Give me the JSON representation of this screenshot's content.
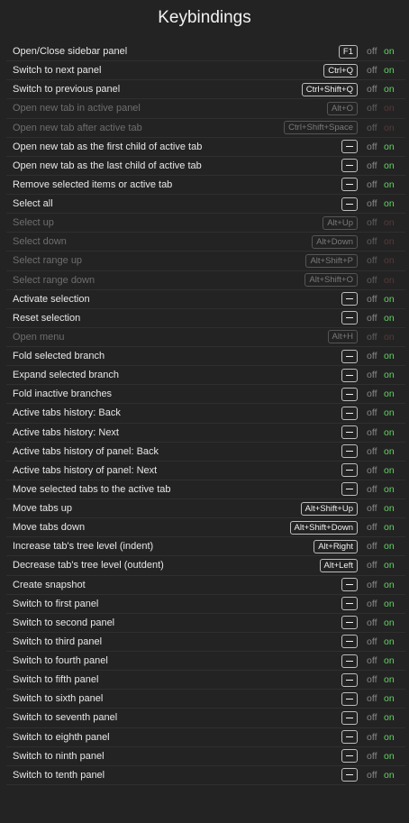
{
  "title": "Keybindings",
  "off_label": "off",
  "on_label": "on",
  "items": [
    {
      "label": "Open/Close sidebar panel",
      "key": "F1",
      "disabled": false
    },
    {
      "label": "Switch to next panel",
      "key": "Ctrl+Q",
      "disabled": false
    },
    {
      "label": "Switch to previous panel",
      "key": "Ctrl+Shift+Q",
      "disabled": false
    },
    {
      "label": "Open new tab in active panel",
      "key": "Alt+O",
      "disabled": true
    },
    {
      "label": "Open new tab after active tab",
      "key": "Ctrl+Shift+Space",
      "disabled": true
    },
    {
      "label": "Open new tab as the first child of active tab",
      "key": "",
      "disabled": false
    },
    {
      "label": "Open new tab as the last child of active tab",
      "key": "",
      "disabled": false
    },
    {
      "label": "Remove selected items or active tab",
      "key": "",
      "disabled": false
    },
    {
      "label": "Select all",
      "key": "",
      "disabled": false
    },
    {
      "label": "Select up",
      "key": "Alt+Up",
      "disabled": true
    },
    {
      "label": "Select down",
      "key": "Alt+Down",
      "disabled": true
    },
    {
      "label": "Select range up",
      "key": "Alt+Shift+P",
      "disabled": true
    },
    {
      "label": "Select range down",
      "key": "Alt+Shift+O",
      "disabled": true
    },
    {
      "label": "Activate selection",
      "key": "",
      "disabled": false
    },
    {
      "label": "Reset selection",
      "key": "",
      "disabled": false
    },
    {
      "label": "Open menu",
      "key": "Alt+H",
      "disabled": true
    },
    {
      "label": "Fold selected branch",
      "key": "",
      "disabled": false
    },
    {
      "label": "Expand selected branch",
      "key": "",
      "disabled": false
    },
    {
      "label": "Fold inactive branches",
      "key": "",
      "disabled": false
    },
    {
      "label": "Active tabs history: Back",
      "key": "",
      "disabled": false
    },
    {
      "label": "Active tabs history: Next",
      "key": "",
      "disabled": false
    },
    {
      "label": "Active tabs history of panel: Back",
      "key": "",
      "disabled": false
    },
    {
      "label": "Active tabs history of panel: Next",
      "key": "",
      "disabled": false
    },
    {
      "label": "Move selected tabs to the active tab",
      "key": "",
      "disabled": false
    },
    {
      "label": "Move tabs up",
      "key": "Alt+Shift+Up",
      "disabled": false
    },
    {
      "label": "Move tabs down",
      "key": "Alt+Shift+Down",
      "disabled": false
    },
    {
      "label": "Increase tab's tree level (indent)",
      "key": "Alt+Right",
      "disabled": false
    },
    {
      "label": "Decrease tab's tree level (outdent)",
      "key": "Alt+Left",
      "disabled": false
    },
    {
      "label": "Create snapshot",
      "key": "",
      "disabled": false
    },
    {
      "label": "Switch to first panel",
      "key": "",
      "disabled": false
    },
    {
      "label": "Switch to second panel",
      "key": "",
      "disabled": false
    },
    {
      "label": "Switch to third panel",
      "key": "",
      "disabled": false
    },
    {
      "label": "Switch to fourth panel",
      "key": "",
      "disabled": false
    },
    {
      "label": "Switch to fifth panel",
      "key": "",
      "disabled": false
    },
    {
      "label": "Switch to sixth panel",
      "key": "",
      "disabled": false
    },
    {
      "label": "Switch to seventh panel",
      "key": "",
      "disabled": false
    },
    {
      "label": "Switch to eighth panel",
      "key": "",
      "disabled": false
    },
    {
      "label": "Switch to ninth panel",
      "key": "",
      "disabled": false
    },
    {
      "label": "Switch to tenth panel",
      "key": "",
      "disabled": false
    }
  ]
}
